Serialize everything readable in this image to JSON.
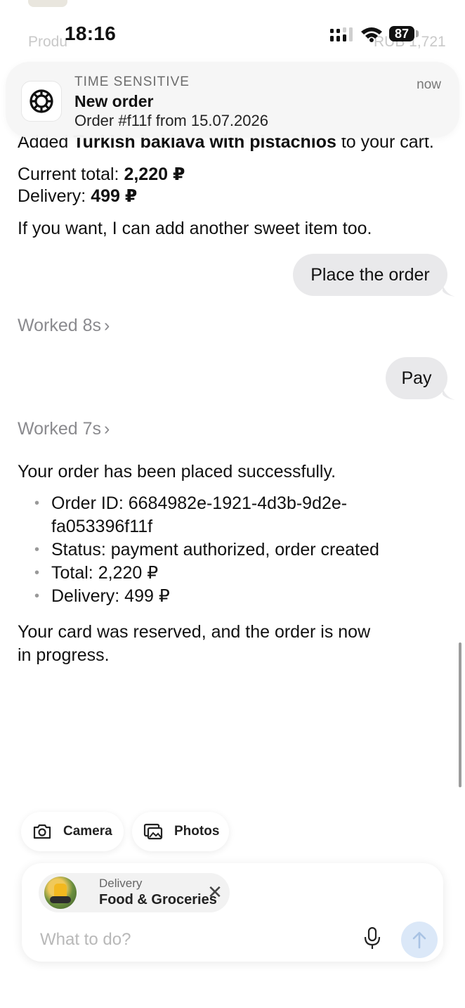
{
  "status_bar": {
    "time": "18:16",
    "battery": "87"
  },
  "background_rows": {
    "product_label": "Produ",
    "product_price": "RUB 1,721"
  },
  "notification": {
    "kicker": "TIME SENSITIVE",
    "title": "New order",
    "body": "Order #f11f from 15.07.2026",
    "time": "now",
    "icon": "openai-knot-icon"
  },
  "chat": {
    "clipped_line": {
      "prefix": "Added ",
      "item": "Turkish baklava with pistachios",
      "suffix": " to your cart."
    },
    "totals": {
      "current_label": "Current total: ",
      "current_value": "2,220 ₽",
      "delivery_label": "Delivery: ",
      "delivery_value": "499 ₽"
    },
    "offer": "If you want, I can add another sweet item too.",
    "user_message_1": "Place the order",
    "worked_1": "Worked 8s",
    "user_message_2": "Pay",
    "worked_2": "Worked 7s",
    "confirmation": "Your order has been placed successfully.",
    "order_details": [
      "Order ID: 6684982e-1921-4d3b-9d2e-",
      "Status: payment authorized, order created",
      "Total: 2,220 ₽",
      "Delivery: 499 ₽"
    ],
    "order_id_wrap": "fa053396f11f",
    "closing_line_1": "Your card was reserved, and the order is now",
    "closing_line_2": "in progress."
  },
  "attachments": {
    "camera_label": "Camera",
    "photos_label": "Photos"
  },
  "composer": {
    "context_kicker": "Delivery",
    "context_title": "Food & Groceries",
    "placeholder": "What to do?"
  },
  "colors": {
    "bubble": "#e9e9eb",
    "send_button": "#dbe8f8",
    "muted": "#8a8a8e"
  }
}
